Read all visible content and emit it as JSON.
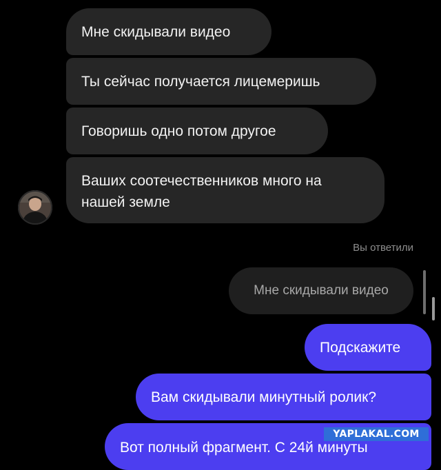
{
  "messages": {
    "incoming": [
      "Мне скидывали видео",
      "Ты сейчас получается лицемеришь",
      "Говоришь одно потом другое",
      "Ваших соотечественников много на нашей земле"
    ],
    "reply_label": "Вы ответили",
    "quoted_text": "Мне скидывали видео",
    "outgoing": [
      "Подскажите",
      "Вам скидывали минутный ролик?",
      "Вот полный фрагмент. С 24й минуты"
    ]
  },
  "watermark": "YAPLAKAL.COM",
  "colors": {
    "background": "#000000",
    "incoming_bubble": "#262626",
    "outgoing_bubble": "#4c3ef0",
    "watermark": "#2f6ed8"
  },
  "icons": [
    "avatar"
  ]
}
